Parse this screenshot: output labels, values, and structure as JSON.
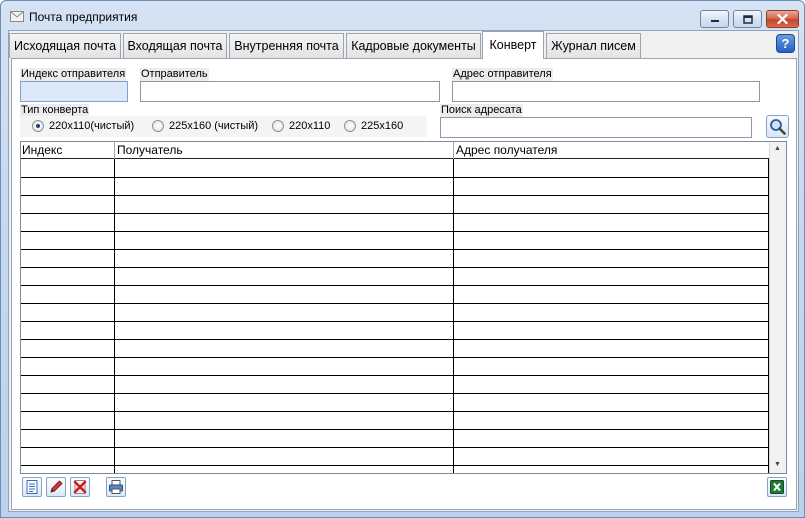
{
  "window": {
    "title": "Почта предприятия"
  },
  "tabs": [
    {
      "label": "Исходящая почта"
    },
    {
      "label": "Входящая почта"
    },
    {
      "label": "Внутренняя почта"
    },
    {
      "label": "Кадровые документы"
    },
    {
      "label": "Конверт",
      "active": true
    },
    {
      "label": "Журнал писем"
    }
  ],
  "help": {
    "label": "?"
  },
  "form": {
    "sender_index_label": "Индекс отправителя",
    "sender_index_value": "",
    "sender_label": "Отправитель",
    "sender_value": "",
    "sender_address_label": "Адрес отправителя",
    "sender_address_value": "",
    "envelope_type_label": "Тип конверта",
    "envelope_types": [
      {
        "label": "220x110(чистый)",
        "selected": true
      },
      {
        "label": "225x160 (чистый)",
        "selected": false
      },
      {
        "label": "220x110",
        "selected": false
      },
      {
        "label": "225x160",
        "selected": false
      }
    ],
    "recipient_search_label": "Поиск адресата",
    "recipient_search_value": ""
  },
  "table": {
    "columns": [
      "Индекс",
      "Получатель",
      "Адрес получателя"
    ],
    "rows": []
  },
  "icons": {
    "window": "envelope-icon",
    "search": "magnifier-icon",
    "new": "new-document-icon",
    "edit": "pencil-icon",
    "delete": "delete-red-x-icon",
    "print": "printer-icon",
    "excel": "excel-icon"
  },
  "colors": {
    "accent_blue": "#2760c4",
    "close_red": "#c7432b",
    "highlight_field": "#dde9f8"
  }
}
